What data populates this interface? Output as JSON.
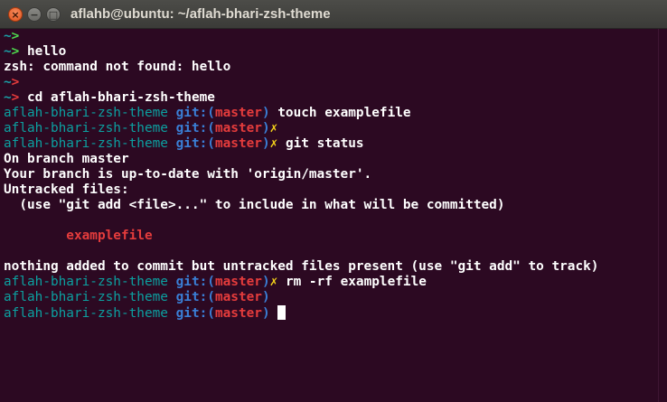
{
  "window": {
    "title": "aflahb@ubuntu: ~/aflah-bhari-zsh-theme",
    "close_glyph": "×",
    "min_glyph": "−",
    "max_glyph": "□"
  },
  "prompt": {
    "tilde": "~",
    "arrow": ">",
    "dir": "aflah-bhari-zsh-theme",
    "git_label": "git:(",
    "close_paren": ")",
    "branch": "master",
    "dirty_mark": "✗"
  },
  "lines": [
    {
      "type": "home",
      "status": "ok",
      "cmd": ""
    },
    {
      "type": "home",
      "status": "ok",
      "cmd": " hello"
    },
    {
      "type": "output",
      "text": "zsh: command not found: hello"
    },
    {
      "type": "home",
      "status": "err",
      "cmd": ""
    },
    {
      "type": "home",
      "status": "err",
      "cmd": " cd aflah-bhari-zsh-theme"
    },
    {
      "type": "repo",
      "dirty": false,
      "cmd": " touch examplefile"
    },
    {
      "type": "repo",
      "dirty": true,
      "cmd": ""
    },
    {
      "type": "repo",
      "dirty": true,
      "cmd": " git status"
    },
    {
      "type": "output",
      "text": "On branch master"
    },
    {
      "type": "output",
      "text": "Your branch is up-to-date with 'origin/master'."
    },
    {
      "type": "output",
      "text": "Untracked files:"
    },
    {
      "type": "output",
      "text": "  (use \"git add <file>...\" to include in what will be committed)"
    },
    {
      "type": "output",
      "text": ""
    },
    {
      "type": "untracked",
      "text": "        examplefile"
    },
    {
      "type": "output",
      "text": ""
    },
    {
      "type": "output",
      "text": "nothing added to commit but untracked files present (use \"git add\" to track)"
    },
    {
      "type": "repo",
      "dirty": true,
      "cmd": " rm -rf examplefile"
    },
    {
      "type": "repo",
      "dirty": false,
      "cmd": ""
    },
    {
      "type": "repo",
      "dirty": false,
      "cmd": " ",
      "cursor": true
    }
  ]
}
